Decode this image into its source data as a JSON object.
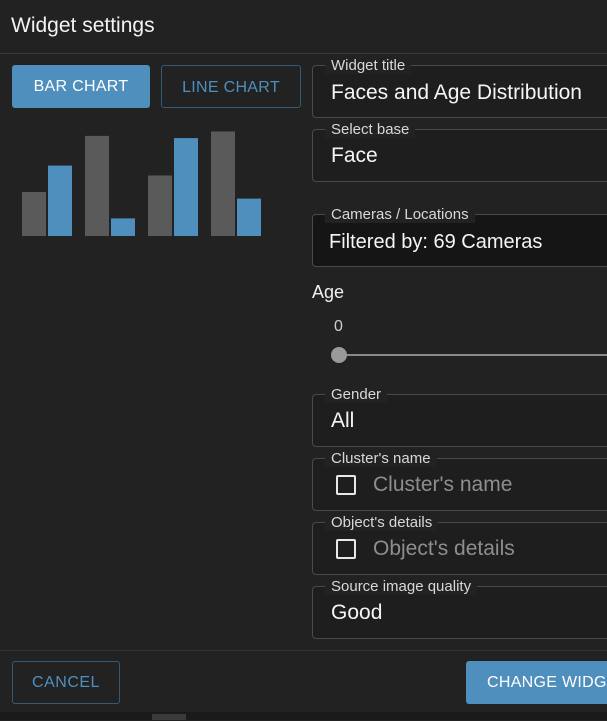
{
  "dialog": {
    "title": "Widget settings"
  },
  "chart_type_tabs": {
    "bar_label": "BAR CHART",
    "line_label": "LINE CHART",
    "selected": "bar"
  },
  "preview_chart": {
    "colors": {
      "gray": "#5a5a5a",
      "blue": "#4f8fbd"
    },
    "groups": [
      {
        "gray": 0.4,
        "blue": 0.64
      },
      {
        "gray": 0.91,
        "blue": 0.16
      },
      {
        "gray": 0.55,
        "blue": 0.89
      },
      {
        "gray": 0.95,
        "blue": 0.34
      }
    ]
  },
  "fields": {
    "widget_title": {
      "label": "Widget title",
      "value": "Faces and Age Distribution"
    },
    "select_base": {
      "label": "Select base",
      "value": "Face"
    },
    "cameras": {
      "label": "Cameras / Locations",
      "value": "Filtered by: 69 Cameras"
    },
    "age": {
      "label": "Age",
      "value": "0"
    },
    "gender": {
      "label": "Gender",
      "value": "All"
    },
    "cluster_name": {
      "label": "Cluster's name",
      "placeholder": "Cluster's name",
      "checked": false
    },
    "object_details": {
      "label": "Object's details",
      "placeholder": "Object's details",
      "checked": false
    },
    "source_quality": {
      "label": "Source image quality",
      "value": "Good"
    }
  },
  "footer": {
    "cancel_label": "CANCEL",
    "change_label": "CHANGE WIDGET"
  },
  "colors": {
    "accent": "#4f8fbd",
    "background": "#222222"
  }
}
